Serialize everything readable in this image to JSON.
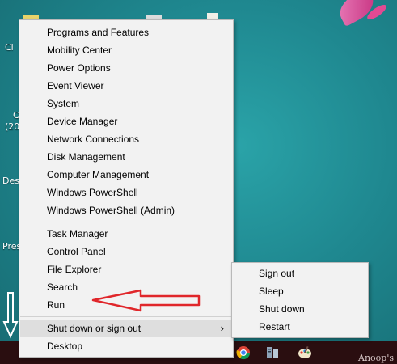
{
  "desktop": {
    "icon_labels": [
      "Cl",
      "C",
      "(20",
      "Des",
      "Pres"
    ]
  },
  "context_menu": {
    "group1": [
      "Programs and Features",
      "Mobility Center",
      "Power Options",
      "Event Viewer",
      "System",
      "Device Manager",
      "Network Connections",
      "Disk Management",
      "Computer Management",
      "Windows PowerShell",
      "Windows PowerShell (Admin)"
    ],
    "group2": [
      "Task Manager",
      "Control Panel",
      "File Explorer",
      "Search",
      "Run"
    ],
    "shutdown_label": "Shut down or sign out",
    "desktop_label": "Desktop"
  },
  "submenu": {
    "items": [
      "Sign out",
      "Sleep",
      "Shut down",
      "Restart"
    ]
  },
  "taskbar": {
    "icons": [
      "chrome-icon",
      "server-icon",
      "paint-icon"
    ]
  },
  "watermark": "Anoop's",
  "colors": {
    "desktop_bg": "#1f8890",
    "menu_bg": "#f2f2f2",
    "highlight": "#dedede",
    "annotation_arrow": "#e0262a",
    "taskbar": "#2a0e10"
  }
}
